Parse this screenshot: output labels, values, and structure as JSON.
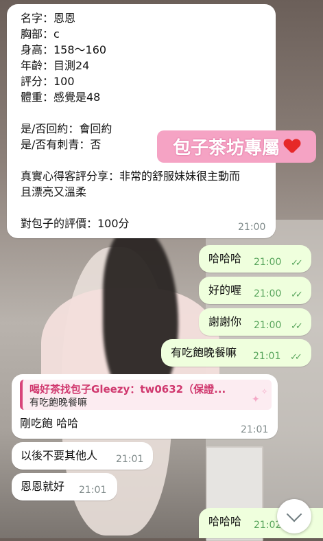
{
  "profile_message": {
    "lines": [
      "名字：恩恩",
      "胸部：c",
      "身高：158～160",
      "年齡：目測24",
      "評分：100",
      "體重：感覺是48",
      "",
      "是/否回約：會回約",
      "是/否有刺青：否",
      "",
      "真實心得客評分享：非常的舒服妹妹很主動而",
      "且漂亮又溫柔",
      "",
      "對包子的評價：100分"
    ],
    "time": "21:00"
  },
  "sticker": {
    "text": "包子茶坊專屬",
    "icon": "heart-icon"
  },
  "sent_messages": [
    {
      "text": "哈哈哈",
      "time": "21:00"
    },
    {
      "text": "好的喔",
      "time": "21:00"
    },
    {
      "text": "謝謝你",
      "time": "21:00"
    },
    {
      "text": "有吃飽晚餐嘛",
      "time": "21:01"
    }
  ],
  "reply_message": {
    "quoted_sender": "喝好茶找包子Gleezy：tw0632（保證...",
    "quoted_text": "有吃飽晚餐嘛",
    "text": "剛吃飽 哈哈",
    "time": "21:01"
  },
  "received_messages": [
    {
      "text": "以後不要其他人",
      "time": "21:01"
    },
    {
      "text": "恩恩就好",
      "time": "21:01"
    }
  ],
  "last_sent": {
    "text": "哈哈哈",
    "time": "21:02"
  },
  "colors": {
    "incoming": "#ffffff",
    "outgoing": "#efffdd",
    "check": "#58a55c",
    "sticker": "#f5a3c4"
  }
}
